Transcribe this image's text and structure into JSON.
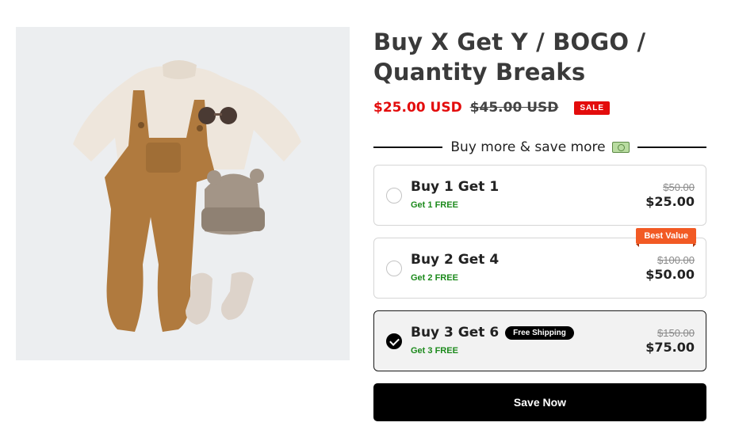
{
  "product": {
    "title_line1": "Buy X Get Y / BOGO /",
    "title_line2": "Quantity Breaks",
    "price": "$25.00 USD",
    "compare_price": "$45.00 USD",
    "sale_badge": "SALE",
    "image_icon": "baby-outfit-image"
  },
  "upsell": {
    "heading": "Buy more & save more",
    "heading_icon": "money-bill-icon"
  },
  "offers": [
    {
      "title": "Buy 1 Get 1",
      "subtitle": "Get 1 FREE",
      "compare_price": "$50.00",
      "price": "$25.00",
      "selected": false
    },
    {
      "title": "Buy 2 Get 4",
      "subtitle": "Get 2 FREE",
      "compare_price": "$100.00",
      "price": "$50.00",
      "selected": false,
      "ribbon": "Best Value"
    },
    {
      "title": "Buy 3 Get 6",
      "subtitle": "Get 3 FREE",
      "compare_price": "$150.00",
      "price": "$75.00",
      "selected": true,
      "tag": "Free Shipping"
    }
  ],
  "cta": {
    "label": "Save Now"
  },
  "colors": {
    "sale_red": "#e30c0c",
    "free_green": "#1c8a1c",
    "best_value_orange": "#f25a24",
    "button_black": "#000000"
  }
}
